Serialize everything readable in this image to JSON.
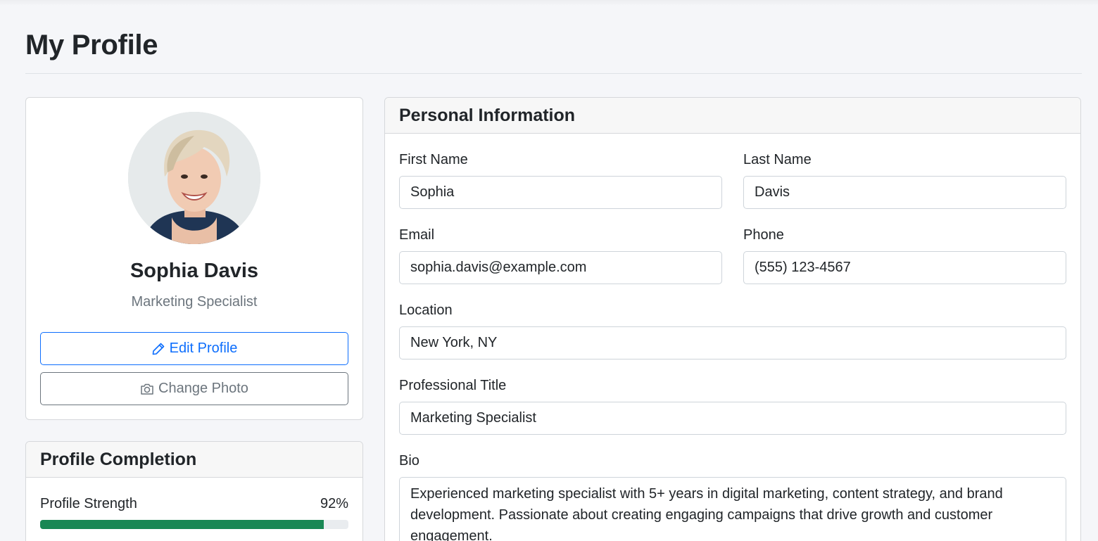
{
  "page": {
    "title": "My Profile"
  },
  "profile": {
    "name": "Sophia Davis",
    "title": "Marketing Specialist",
    "edit_label": "Edit Profile",
    "edit_icon": "pencil-icon",
    "photo_label": "Change Photo",
    "photo_icon": "camera-icon"
  },
  "completion": {
    "header": "Profile Completion",
    "strength_label": "Profile Strength",
    "strength_value": "92%",
    "strength_fraction": 0.92,
    "bar_color": "#198754"
  },
  "info": {
    "header": "Personal Information",
    "first_name": {
      "label": "First Name",
      "value": "Sophia"
    },
    "last_name": {
      "label": "Last Name",
      "value": "Davis"
    },
    "email": {
      "label": "Email",
      "value": "sophia.davis@example.com"
    },
    "phone": {
      "label": "Phone",
      "value": "(555) 123-4567"
    },
    "location": {
      "label": "Location",
      "value": "New York, NY"
    },
    "professional_title": {
      "label": "Professional Title",
      "value": "Marketing Specialist"
    },
    "bio": {
      "label": "Bio",
      "value": "Experienced marketing specialist with 5+ years in digital marketing, content strategy, and brand development. Passionate about creating engaging campaigns that drive growth and customer engagement."
    }
  },
  "colors": {
    "primary": "#0d6efd",
    "secondary": "#6c757d",
    "success": "#198754"
  }
}
